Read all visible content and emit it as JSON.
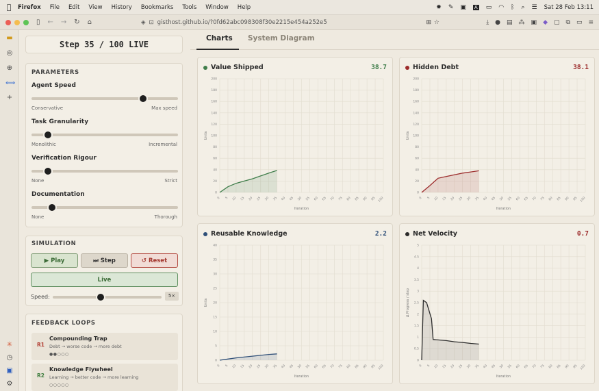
{
  "menubar": {
    "app": "Firefox",
    "items": [
      "File",
      "Edit",
      "View",
      "History",
      "Bookmarks",
      "Tools",
      "Window",
      "Help"
    ],
    "datetime": "Sat 28 Feb  13:11"
  },
  "browser": {
    "url": "gisthost.github.io/?0fd62abc098308f30e2215e454a252e5"
  },
  "status": {
    "step_text": "Step 35 / 100 LIVE"
  },
  "parameters": {
    "title": "PARAMETERS",
    "sliders": [
      {
        "label": "Agent Speed",
        "min_label": "Conservative",
        "max_label": "Max speed",
        "value": 0.76
      },
      {
        "label": "Task Granularity",
        "min_label": "Monolithic",
        "max_label": "Incremental",
        "value": 0.11
      },
      {
        "label": "Verification Rigour",
        "min_label": "None",
        "max_label": "Strict",
        "value": 0.11
      },
      {
        "label": "Documentation",
        "min_label": "None",
        "max_label": "Thorough",
        "value": 0.14
      }
    ]
  },
  "simulation": {
    "title": "SIMULATION",
    "play": "▶ Play",
    "step": "⏭ Step",
    "reset": "↺ Reset",
    "live": "Live",
    "speed_label": "Speed:",
    "speed_value": "5×",
    "speed_level": 0.44
  },
  "feedback": {
    "title": "FEEDBACK LOOPS",
    "loops": [
      {
        "tag": "R1",
        "name": "Compounding Trap",
        "desc": "Debt → worse code → more debt",
        "dots": "●●○○○"
      },
      {
        "tag": "R2",
        "name": "Knowledge Flywheel",
        "desc": "Learning → better code → more learning",
        "dots": "○○○○○"
      }
    ]
  },
  "tabs": {
    "charts": "Charts",
    "system": "System Diagram"
  },
  "colors": {
    "green": "#3f7d4a",
    "red": "#9c2b2b",
    "blue": "#2f4f78",
    "dark": "#2b2b2b"
  },
  "chart_data": [
    {
      "type": "area",
      "title": "Value Shipped",
      "current": "38.7",
      "ylabel": "Units",
      "xlabel": "Iteration",
      "ylim": [
        0,
        200
      ],
      "yticks": [
        0,
        20,
        40,
        60,
        80,
        100,
        120,
        140,
        160,
        180,
        200
      ],
      "xticks": [
        0,
        5,
        10,
        15,
        20,
        25,
        30,
        35,
        40,
        45,
        50,
        55,
        60,
        65,
        70,
        75,
        80,
        85,
        90,
        95,
        100
      ],
      "x": [
        0,
        5,
        10,
        15,
        20,
        25,
        30,
        35
      ],
      "y": [
        0,
        10,
        16,
        20,
        24,
        29,
        34,
        38.7
      ]
    },
    {
      "type": "area",
      "title": "Hidden Debt",
      "current": "38.1",
      "ylabel": "Units",
      "xlabel": "Iteration",
      "ylim": [
        0,
        200
      ],
      "yticks": [
        0,
        20,
        40,
        60,
        80,
        100,
        120,
        140,
        160,
        180,
        200
      ],
      "xticks": [
        0,
        5,
        10,
        15,
        20,
        25,
        30,
        35,
        40,
        45,
        50,
        55,
        60,
        65,
        70,
        75,
        80,
        85,
        90,
        95,
        100
      ],
      "x": [
        0,
        5,
        10,
        15,
        20,
        25,
        30,
        35
      ],
      "y": [
        0,
        12,
        25,
        28,
        31,
        34,
        36,
        38.1
      ]
    },
    {
      "type": "area",
      "title": "Reusable Knowledge",
      "current": "2.2",
      "ylabel": "Units",
      "xlabel": "Iteration",
      "ylim": [
        0,
        40
      ],
      "yticks": [
        0,
        5,
        10,
        15,
        20,
        25,
        30,
        35,
        40
      ],
      "xticks": [
        0,
        5,
        10,
        15,
        20,
        25,
        30,
        35,
        40,
        45,
        50,
        55,
        60,
        65,
        70,
        75,
        80,
        85,
        90,
        95,
        100
      ],
      "x": [
        0,
        5,
        10,
        15,
        20,
        25,
        30,
        35
      ],
      "y": [
        0,
        0.4,
        0.8,
        1.1,
        1.4,
        1.7,
        2.0,
        2.2
      ]
    },
    {
      "type": "area",
      "title": "Net Velocity",
      "current": "0.7",
      "ylabel": "Δ Progress / step",
      "xlabel": "Iteration",
      "ylim": [
        0,
        5
      ],
      "yticks": [
        0,
        0.5,
        1.0,
        1.5,
        2.0,
        2.5,
        3.0,
        3.5,
        4.0,
        4.5,
        5.0
      ],
      "xticks": [
        0,
        5,
        10,
        15,
        20,
        25,
        30,
        35,
        40,
        45,
        50,
        55,
        60,
        65,
        70,
        75,
        80,
        85,
        90,
        95,
        100
      ],
      "x": [
        0,
        1,
        3,
        6,
        7,
        10,
        15,
        20,
        25,
        30,
        35
      ],
      "y": [
        0,
        2.6,
        2.5,
        1.8,
        0.9,
        0.88,
        0.85,
        0.8,
        0.77,
        0.73,
        0.7
      ]
    }
  ]
}
